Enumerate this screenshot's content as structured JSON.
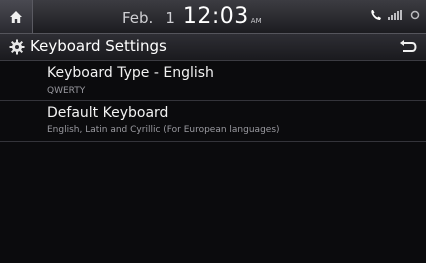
{
  "status": {
    "date": "Feb.",
    "day": "1",
    "time": "12:03",
    "ampm": "AM"
  },
  "icons": {
    "home": "home-icon",
    "phone": "phone-icon",
    "signal": "signal-icon",
    "gear": "gear-icon",
    "back": "back-icon"
  },
  "header": {
    "title": "Keyboard Settings"
  },
  "items": [
    {
      "label": "Keyboard Type - English",
      "value": "QWERTY"
    },
    {
      "label": "Default Keyboard",
      "value": "English, Latin and Cyrillic (For European languages)"
    }
  ]
}
